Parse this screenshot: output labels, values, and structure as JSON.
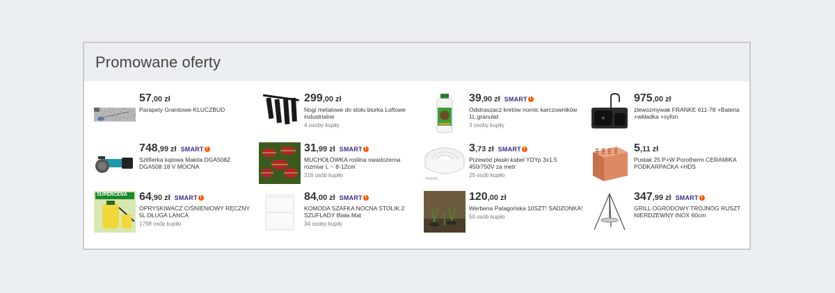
{
  "section": {
    "title": "Promowane oferty"
  },
  "smart_label": "SMART",
  "smart_badge": "!",
  "offers": [
    {
      "price_int": "57",
      "price_dec": ",00",
      "currency": "zł",
      "smart": false,
      "title": "Parapety Granitowe KLUCZBUD",
      "buyers": "",
      "thumb": "granite-sill-image"
    },
    {
      "price_int": "299",
      "price_dec": ",00",
      "currency": "zł",
      "smart": false,
      "title": "Nogi metalowe do stołu biurka Loftowe industrialne",
      "buyers": "4 osoby kupiły",
      "thumb": "table-legs-image"
    },
    {
      "price_int": "39",
      "price_dec": ",90",
      "currency": "zł",
      "smart": true,
      "title": "Odstraszacz kretów nornic karczowników 1L granulat",
      "buyers": "3 osoby kupiły",
      "thumb": "mole-repellent-bottle-image"
    },
    {
      "price_int": "975",
      "price_dec": ",00",
      "currency": "zł",
      "smart": false,
      "title": "zlewozmywak FRANKE 611-78 +Bateria +wkładka +syfon",
      "buyers": "",
      "thumb": "sink-image"
    },
    {
      "price_int": "748",
      "price_dec": ",99",
      "currency": "zł",
      "smart": true,
      "title": "Szlifierka kątowa Makita DGA508Z DGA508 18 V MOCNA",
      "buyers": "",
      "thumb": "angle-grinder-image"
    },
    {
      "price_int": "31",
      "price_dec": ",99",
      "currency": "zł",
      "smart": true,
      "title": "MUCHOŁÓWKA roślina owadożerna rozmiar L ~`8-12cm`",
      "buyers": "216 osób kupiło",
      "thumb": "venus-flytrap-image"
    },
    {
      "price_int": "3",
      "price_dec": ",73",
      "currency": "zł",
      "smart": true,
      "title": "Przewód płaski kabel YDYp 3x1,5 450/750V za metr",
      "buyers": "25 osób kupiło",
      "thumb": "cable-roll-image"
    },
    {
      "price_int": "5",
      "price_dec": ",11",
      "currency": "zł",
      "smart": false,
      "title": "Pustak 25 P+W Porotherm CERAMIKA PODKARPACKA +HDS",
      "buyers": "",
      "thumb": "ceramic-block-image"
    },
    {
      "price_int": "64",
      "price_dec": ",90",
      "currency": "zł",
      "smart": true,
      "title": "OPRYSKIWACZ CIŚNIENIOWY RĘCZNY 5L DŁUGA LANCA",
      "buyers": "1798 osób kupiło",
      "thumb": "pressure-sprayer-image",
      "thumb_badge": "SUPERCENA"
    },
    {
      "price_int": "84",
      "price_dec": ",00",
      "currency": "zł",
      "smart": true,
      "title": "KOMODA SZAFKA NOCNA STOLIK 2 SZUFLADY Biała Mat",
      "buyers": "34 osoby kupiły",
      "thumb": "white-nightstand-image"
    },
    {
      "price_int": "120",
      "price_dec": ",00",
      "currency": "zł",
      "smart": false,
      "title": "Werbena Patagońska 10SZT! SADZONKA!",
      "buyers": "50 osób kupiło",
      "thumb": "verbena-seedlings-image"
    },
    {
      "price_int": "347",
      "price_dec": ",99",
      "currency": "zł",
      "smart": true,
      "title": "GRILL OGRODOWY TRÓJNÓG RUSZT NIERDZEWNY INOX 60cm",
      "buyers": "",
      "thumb": "tripod-grill-image"
    }
  ],
  "colors": {
    "page_bg": "#eceff1",
    "header_bg": "#eceff1",
    "smart_text": "#3e2a8c",
    "smart_badge": "#ff5a00"
  }
}
